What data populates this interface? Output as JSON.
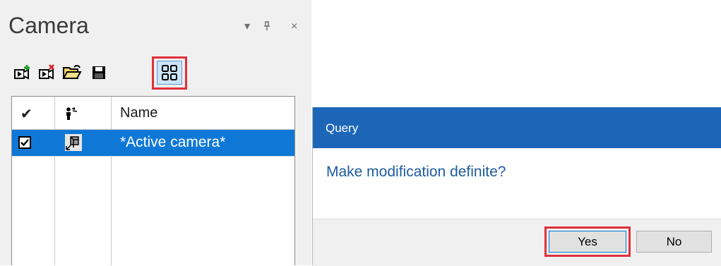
{
  "panel": {
    "title": "Camera",
    "controls": {
      "dropdown": "▾",
      "pin": "ᵖ",
      "close": "×"
    },
    "toolbar": [
      "new-camera-icon",
      "delete-camera-icon",
      "open-folder-icon",
      "save-icon",
      "grid-view-icon"
    ],
    "grid": {
      "headers": {
        "check": "✔",
        "icon": "",
        "name": "Name"
      },
      "rows": [
        {
          "checked": true,
          "name": "*Active camera*"
        }
      ]
    }
  },
  "dialog": {
    "title": "Query",
    "message": "Make modification definite?",
    "buttons": {
      "yes": "Yes",
      "no": "No"
    }
  },
  "colors": {
    "selection": "#0f78d7",
    "dialog_title": "#1c66b8",
    "highlight": "#e0303a",
    "message": "#1d5a9e"
  }
}
